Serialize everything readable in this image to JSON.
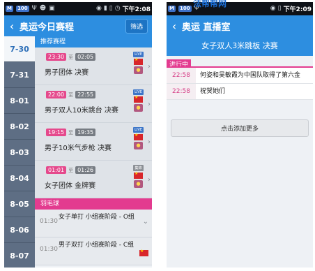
{
  "status_bar": {
    "left_time": "下午2:08",
    "right_time": "下午2:09",
    "badge": "100"
  },
  "left": {
    "title": "奥运今日赛程",
    "filter_label": "筛选",
    "dates": [
      "7-30",
      "7-31",
      "8-01",
      "8-02",
      "8-03",
      "8-04",
      "8-05",
      "8-06",
      "8-07"
    ],
    "active_date": "7-30",
    "section_recommended": "推荐赛程",
    "events": [
      {
        "start": "23:30",
        "to": "至",
        "end": "02:05",
        "name": "男子团体 决赛",
        "badge": "LIVE"
      },
      {
        "start": "22:00",
        "to": "至",
        "end": "22:55",
        "name": "男子双人10米跳台 决赛",
        "badge": "LIVE"
      },
      {
        "start": "19:15",
        "to": "至",
        "end": "19:35",
        "name": "男子10米气步枪 决赛",
        "badge": "LIVE"
      },
      {
        "start": "01:01",
        "to": "至",
        "end": "01:26",
        "name": "女子团体 金牌赛",
        "badge": "集锦"
      }
    ],
    "section_badminton": "羽毛球",
    "badminton_events": [
      {
        "time": "01:30",
        "name": "女子单打 小组赛阶段 - O组"
      },
      {
        "time": "01:30",
        "name": "男子双打 小组赛阶段 - C组"
      }
    ]
  },
  "right": {
    "title": "奥运 直播室",
    "event_title": "女子双人3米跳板 决赛",
    "live_tag": "进行中",
    "feed": [
      {
        "time": "22:58",
        "text": "何姿和吴敏霞为中国队取得了第六金"
      },
      {
        "time": "22:58",
        "text": "祝贺她们"
      }
    ],
    "more_button": "点击添加更多"
  },
  "watermark": "法帮帮网"
}
